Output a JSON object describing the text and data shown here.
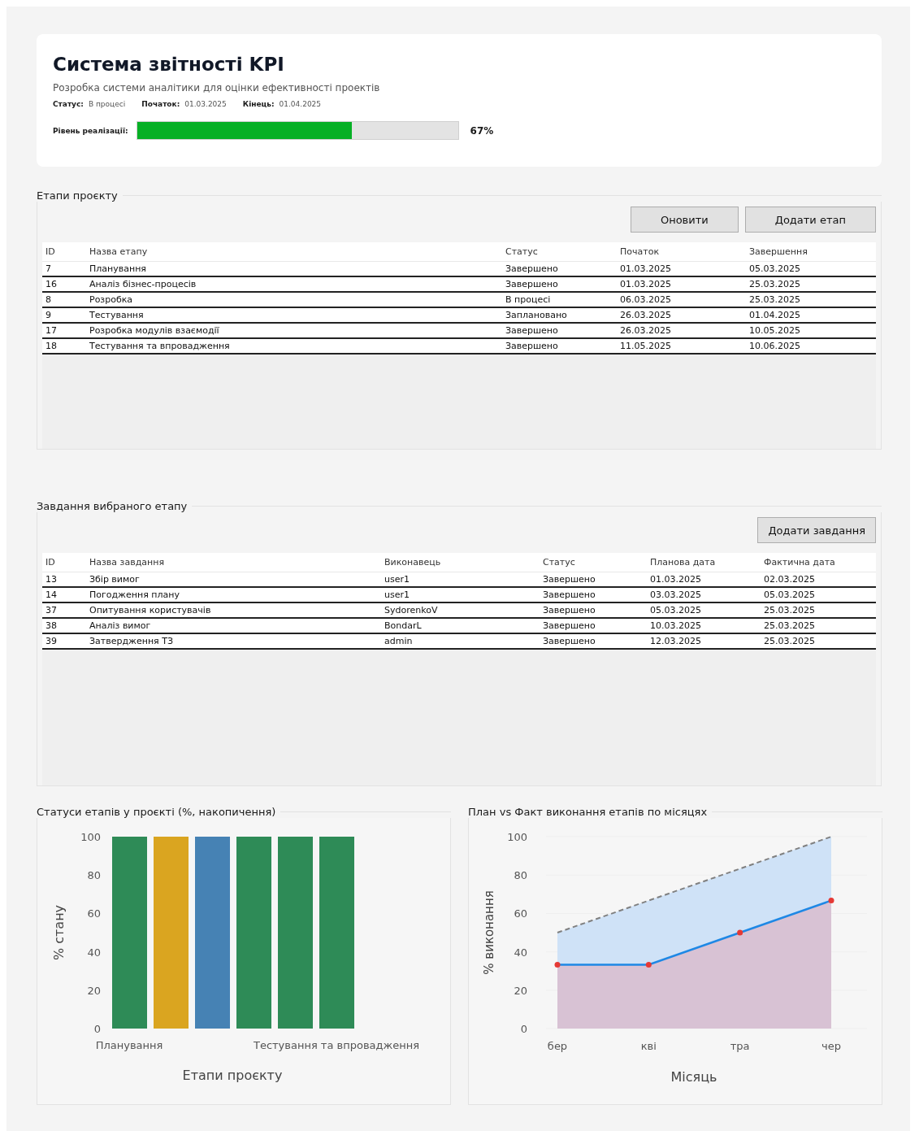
{
  "project": {
    "title": "Система звітності KPI",
    "description": "Розробка системи аналітики для оцінки ефективності проектів",
    "meta": [
      {
        "label": "Статус:",
        "value": "В процесі"
      },
      {
        "label": "Початок:",
        "value": "01.03.2025"
      },
      {
        "label": "Кінець:",
        "value": "01.04.2025"
      }
    ],
    "progress": {
      "label": "Рівень реалізації:",
      "level": 0.67,
      "reading": "67%"
    }
  },
  "stages": {
    "title": "Етапи проєкту",
    "buttons": [
      "Оновити",
      "Додати етап"
    ],
    "columns": [
      "ID",
      "Назва етапу",
      "Статус",
      "Початок",
      "Завершення"
    ],
    "rows": [
      [
        "7",
        "Планування",
        "Завершено",
        "01.03.2025",
        "05.03.2025"
      ],
      [
        "16",
        "Аналіз бізнес-процесів",
        "Завершено",
        "01.03.2025",
        "25.03.2025"
      ],
      [
        "8",
        "Розробка",
        "В процесі",
        "06.03.2025",
        "25.03.2025"
      ],
      [
        "9",
        "Тестування",
        "Заплановано",
        "26.03.2025",
        "01.04.2025"
      ],
      [
        "17",
        "Розробка модулів взаємодії",
        "Завершено",
        "26.03.2025",
        "10.05.2025"
      ],
      [
        "18",
        "Тестування та впровадження",
        "Завершено",
        "11.05.2025",
        "10.06.2025"
      ]
    ]
  },
  "tasks": {
    "title": "Завдання вибраного етапу",
    "buttons": [
      "Додати завдання"
    ],
    "columns": [
      "ID",
      "Назва завдання",
      "Виконавець",
      "Статус",
      "Планова дата",
      "Фактична дата"
    ],
    "rows": [
      [
        "13",
        "Збір вимог",
        "user1",
        "Завершено",
        "01.03.2025",
        "02.03.2025"
      ],
      [
        "14",
        "Погодження плану",
        "user1",
        "Завершено",
        "03.03.2025",
        "05.03.2025"
      ],
      [
        "37",
        "Опитування користувачів",
        "SydorenkoV",
        "Завершено",
        "05.03.2025",
        "25.03.2025"
      ],
      [
        "38",
        "Аналіз вимог",
        "BondarL",
        "Завершено",
        "10.03.2025",
        "25.03.2025"
      ],
      [
        "39",
        "Затвердження ТЗ",
        "admin",
        "Завершено",
        "12.03.2025",
        "25.03.2025"
      ]
    ]
  },
  "status_chart": {
    "title": "Статуси етапів у проєкті (%, накопичення)",
    "chart_data": {
      "type": "bar",
      "xlabel": "Етапи проєкту",
      "ylabel": "% стану",
      "categories": [
        "Планування",
        null,
        null,
        null,
        null,
        "Тестування та впровадження"
      ],
      "series": [
        {
          "color": "#2e8b57",
          "values": [
            100,
            null,
            null,
            100,
            100,
            100
          ]
        },
        {
          "color": "#daa520",
          "values": [
            null,
            100,
            null,
            null,
            null,
            null
          ]
        },
        {
          "color": "#4682b4",
          "values": [
            null,
            null,
            100,
            null,
            null,
            null
          ]
        }
      ],
      "ylim": [
        0,
        100
      ],
      "yticks": [
        0,
        20,
        40,
        60,
        80,
        100
      ]
    }
  },
  "plan_chart": {
    "title": "План vs Факт виконання етапів по місяцях",
    "chart_data": {
      "type": "area",
      "xlabel": "Місяць",
      "ylabel": "% виконання",
      "categories": [
        "бер",
        "кві",
        "тра",
        "чер"
      ],
      "series": [
        {
          "color": "#808080",
          "values": [
            50,
            66.7,
            83.3,
            100
          ]
        },
        {
          "color": "#1e88e5",
          "values": [
            33.3,
            33.3,
            50,
            66.7
          ]
        }
      ],
      "ylim": [
        0,
        100
      ],
      "yticks": [
        0,
        20,
        40,
        60,
        80,
        100
      ]
    }
  }
}
